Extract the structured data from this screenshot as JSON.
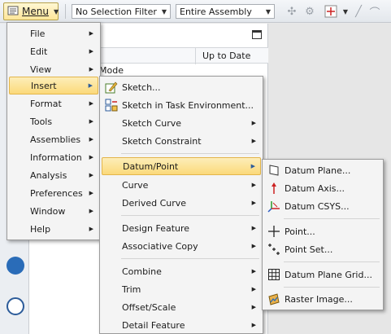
{
  "toolbar": {
    "menu_label": "Menu",
    "selection_filter": "No Selection Filter",
    "scope": "Entire Assembly"
  },
  "navigator": {
    "col_up_to_date": "Up to Date",
    "mode_text": "Mode"
  },
  "main_menu": {
    "items": [
      {
        "label": "File"
      },
      {
        "label": "Edit"
      },
      {
        "label": "View"
      },
      {
        "label": "Insert"
      },
      {
        "label": "Format"
      },
      {
        "label": "Tools"
      },
      {
        "label": "Assemblies"
      },
      {
        "label": "Information"
      },
      {
        "label": "Analysis"
      },
      {
        "label": "Preferences"
      },
      {
        "label": "Window"
      },
      {
        "label": "Help"
      }
    ]
  },
  "insert_menu": {
    "items": [
      {
        "label": "Sketch..."
      },
      {
        "label": "Sketch in Task Environment..."
      },
      {
        "label": "Sketch Curve"
      },
      {
        "label": "Sketch Constraint"
      },
      {
        "label": "Datum/Point"
      },
      {
        "label": "Curve"
      },
      {
        "label": "Derived Curve"
      },
      {
        "label": "Design Feature"
      },
      {
        "label": "Associative Copy"
      },
      {
        "label": "Combine"
      },
      {
        "label": "Trim"
      },
      {
        "label": "Offset/Scale"
      },
      {
        "label": "Detail Feature"
      }
    ]
  },
  "datum_menu": {
    "items": [
      {
        "label": "Datum Plane..."
      },
      {
        "label": "Datum Axis..."
      },
      {
        "label": "Datum CSYS..."
      },
      {
        "label": "Point..."
      },
      {
        "label": "Point Set..."
      },
      {
        "label": "Datum Plane Grid..."
      },
      {
        "label": "Raster Image..."
      }
    ]
  },
  "colors": {
    "highlight": "#fbd97a",
    "highlight_border": "#e3b54a",
    "menu_bg": "#f4f4f4"
  }
}
